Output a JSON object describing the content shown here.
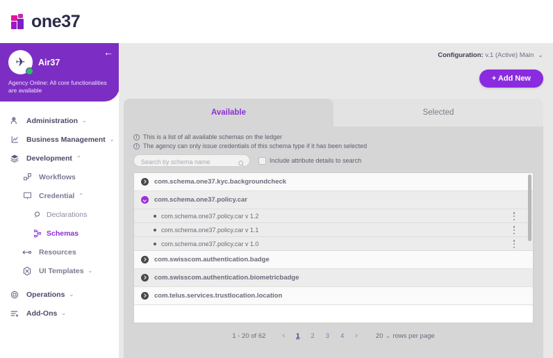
{
  "brand": {
    "name": "one37",
    "logo_icon": "one37-logo-icon"
  },
  "sidebar": {
    "collapse_icon": "arrow-left-icon",
    "agency": {
      "name": "Air37",
      "avatar_icon": "airplane-globe-avatar-icon",
      "status_icon": "online-status-dot",
      "status_text": "Agency Online: All core functionalities are available"
    },
    "items": [
      {
        "label": "Administration",
        "icon": "administration-icon",
        "caret": "⌄",
        "level": 0,
        "active": false
      },
      {
        "label": "Business Management",
        "icon": "business-management-icon",
        "caret": "⌄",
        "level": 0,
        "active": false
      },
      {
        "label": "Development",
        "icon": "development-stack-icon",
        "caret": "⌃",
        "level": 0,
        "active": false
      },
      {
        "label": "Workflows",
        "icon": "workflows-icon",
        "caret": "",
        "level": 1,
        "active": false
      },
      {
        "label": "Credential",
        "icon": "credential-icon",
        "caret": "⌃",
        "level": 1,
        "active": false
      },
      {
        "label": "Declarations",
        "icon": "declarations-search-icon",
        "caret": "",
        "level": 2,
        "active": false
      },
      {
        "label": "Schemas",
        "icon": "schemas-nodes-icon",
        "caret": "",
        "level": 2,
        "active": true
      },
      {
        "label": "Resources",
        "icon": "resources-arrows-icon",
        "caret": "",
        "level": 1,
        "active": false
      },
      {
        "label": "UI Templates",
        "icon": "ui-templates-icon",
        "caret": "⌄",
        "level": 1,
        "active": false
      },
      {
        "label": "Operations",
        "icon": "operations-gear-icon",
        "caret": "⌄",
        "level": 0,
        "active": false
      },
      {
        "label": "Add-Ons",
        "icon": "add-ons-icon",
        "caret": "⌄",
        "level": 0,
        "active": false
      }
    ]
  },
  "topbar": {
    "configuration_label": "Configuration:",
    "configuration_value": "v.1 (Active) Main",
    "configuration_chevron": "⌄",
    "add_new_label": "+ Add New"
  },
  "tabs": [
    {
      "label": "Available",
      "active": true
    },
    {
      "label": "Selected",
      "active": false
    }
  ],
  "panel": {
    "info_lines": [
      "This is a list of all available schemas on the ledger",
      "The agency can only issue credentials of this schema type if it has been selected"
    ],
    "info_icon": "info-circle-icon",
    "search": {
      "placeholder": "Search by schema name",
      "value": "",
      "icon": "search-icon"
    },
    "checkbox": {
      "label": "Include attribute details to search",
      "checked": false
    }
  },
  "schema_list": [
    {
      "name": "com.schema.one37.kyc.backgroundcheck",
      "expanded": false,
      "shade": "light",
      "versions": []
    },
    {
      "name": "com.schema.one37.policy.car",
      "expanded": true,
      "shade": "alt",
      "versions": [
        {
          "label": "com.schema.one37.policy.car v 1.2",
          "menu_icon": "kebab-menu-icon"
        },
        {
          "label": "com.schema.one37.policy.car v 1.1",
          "menu_icon": "kebab-menu-icon"
        },
        {
          "label": "com.schema.one37.policy.car v 1.0",
          "menu_icon": "kebab-menu-icon"
        }
      ]
    },
    {
      "name": "com.swisscom.authentication.badge",
      "expanded": false,
      "shade": "light",
      "versions": []
    },
    {
      "name": "com.swisscom.authentication.biometricbadge",
      "expanded": false,
      "shade": "alt",
      "versions": []
    },
    {
      "name": "com.telus.services.trustlocation.location",
      "expanded": false,
      "shade": "light",
      "versions": []
    }
  ],
  "pagination": {
    "range": "1 - 20 of 62",
    "prev_icon": "‹",
    "next_icon": "›",
    "pages": [
      "1",
      "2",
      "3",
      "4"
    ],
    "current_page": "1",
    "rows_per_page_value": "20",
    "rows_per_page_chevron": "⌄",
    "rows_per_page_label": "rows per page"
  },
  "colors": {
    "brand_purple": "#7c2ec4",
    "accent_purple": "#8b2fd6",
    "button_purple": "#8a2be0",
    "online_green": "#22c65a",
    "panel_gray": "#d6d6d6",
    "content_gray": "#e8e8e8"
  }
}
